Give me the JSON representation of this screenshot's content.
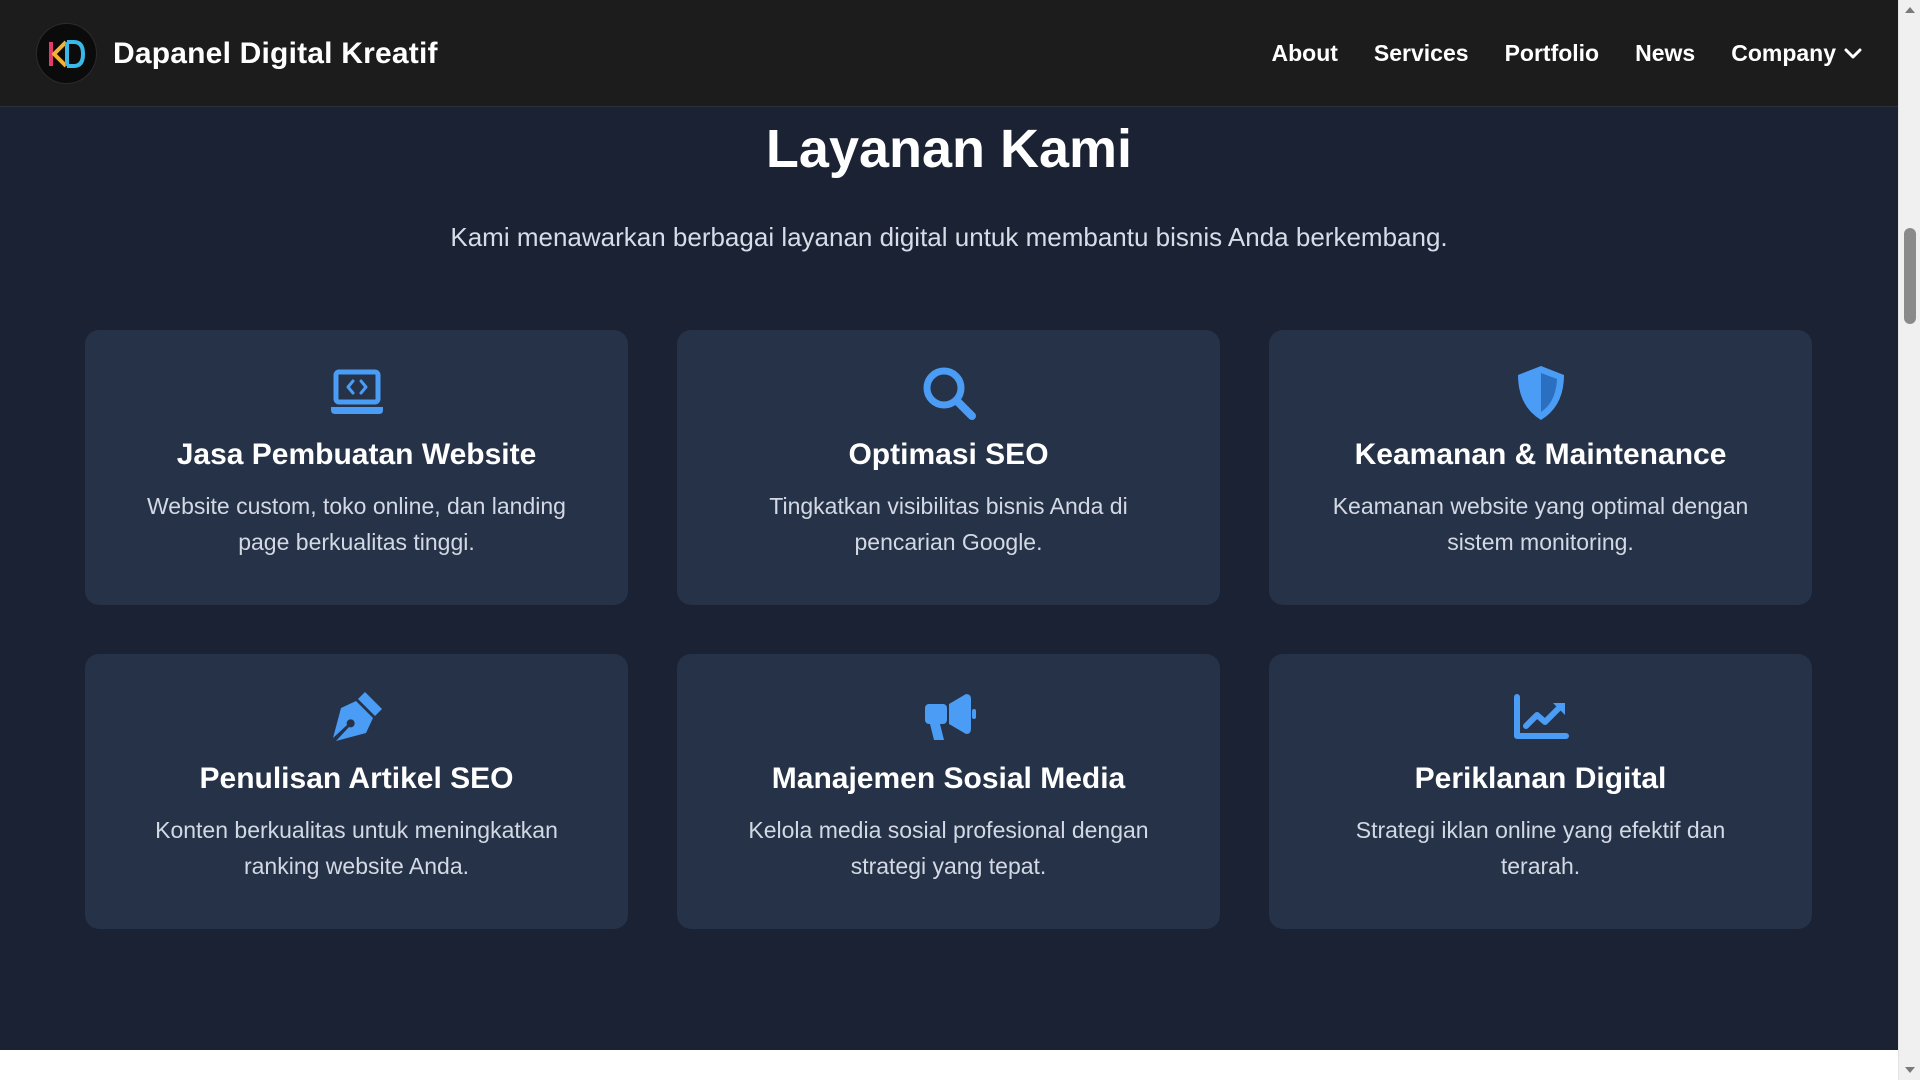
{
  "colors": {
    "accent": "#4a9cf5",
    "navbar_bg": "#1c1c1c",
    "page_bg": "#1b2233",
    "card_bg": "#263247"
  },
  "header": {
    "brand_name": "Dapanel Digital Kreatif",
    "logo_icon": "kd-logo-icon",
    "nav": [
      {
        "label": "About"
      },
      {
        "label": "Services"
      },
      {
        "label": "Portfolio"
      },
      {
        "label": "News"
      },
      {
        "label": "Company",
        "icon": "chevron-down-icon"
      }
    ]
  },
  "services": {
    "title": "Layanan Kami",
    "subtitle": "Kami menawarkan berbagai layanan digital untuk membantu bisnis Anda berkembang.",
    "cards": [
      {
        "icon": "laptop-code-icon",
        "title": "Jasa Pembuatan Website",
        "desc": "Website custom, toko online, dan landing page berkualitas tinggi."
      },
      {
        "icon": "search-icon",
        "title": "Optimasi SEO",
        "desc": "Tingkatkan visibilitas bisnis Anda di pencarian Google."
      },
      {
        "icon": "shield-icon",
        "title": "Keamanan & Maintenance",
        "desc": "Keamanan website yang optimal dengan sistem monitoring."
      },
      {
        "icon": "pen-nib-icon",
        "title": "Penulisan Artikel SEO",
        "desc": "Konten berkualitas untuk meningkatkan ranking website Anda."
      },
      {
        "icon": "megaphone-icon",
        "title": "Manajemen Sosial Media",
        "desc": "Kelola media sosial profesional dengan strategi yang tepat."
      },
      {
        "icon": "chart-line-icon",
        "title": "Periklanan Digital",
        "desc": "Strategi iklan online yang efektif dan terarah."
      }
    ]
  }
}
